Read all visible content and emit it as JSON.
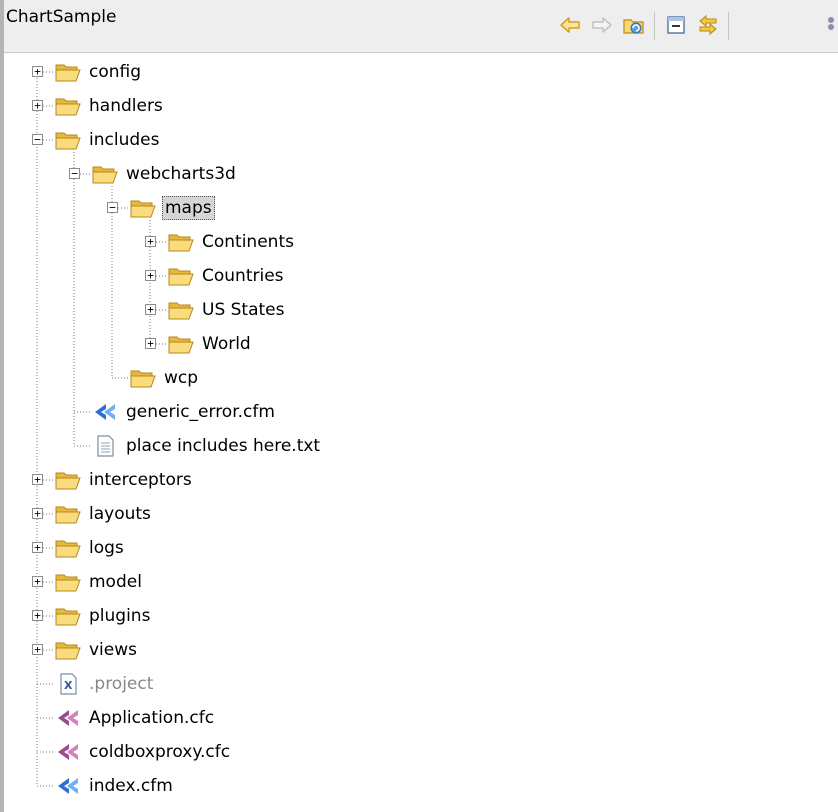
{
  "title": "ChartSample",
  "toolbar": {
    "icons": [
      "back-arrow-icon",
      "forward-arrow-icon",
      "refresh-icon",
      "collapse-all-icon",
      "link-with-editor-icon",
      "view-menu-icon"
    ]
  },
  "tree": [
    {
      "id": "config",
      "label": "config",
      "type": "folder",
      "level": 0,
      "state": "collapsed"
    },
    {
      "id": "handlers",
      "label": "handlers",
      "type": "folder",
      "level": 0,
      "state": "collapsed"
    },
    {
      "id": "includes",
      "label": "includes",
      "type": "folder",
      "level": 0,
      "state": "expanded"
    },
    {
      "id": "webcharts3d",
      "label": "webcharts3d",
      "type": "folder",
      "level": 1,
      "state": "expanded"
    },
    {
      "id": "maps",
      "label": "maps",
      "type": "folder",
      "level": 2,
      "state": "expanded",
      "selected": true
    },
    {
      "id": "continents",
      "label": "Continents",
      "type": "folder",
      "level": 3,
      "state": "collapsed"
    },
    {
      "id": "countries",
      "label": "Countries",
      "type": "folder",
      "level": 3,
      "state": "collapsed"
    },
    {
      "id": "us-states",
      "label": "US States",
      "type": "folder",
      "level": 3,
      "state": "collapsed"
    },
    {
      "id": "world",
      "label": "World",
      "type": "folder",
      "level": 3,
      "state": "collapsed"
    },
    {
      "id": "wcp",
      "label": "wcp",
      "type": "folder",
      "level": 2,
      "state": "leaf"
    },
    {
      "id": "generic-error",
      "label": "generic_error.cfm",
      "type": "cf",
      "level": 1,
      "state": "leaf"
    },
    {
      "id": "place-includes",
      "label": "place includes here.txt",
      "type": "txt",
      "level": 1,
      "state": "leaf"
    },
    {
      "id": "interceptors",
      "label": "interceptors",
      "type": "folder",
      "level": 0,
      "state": "collapsed"
    },
    {
      "id": "layouts",
      "label": "layouts",
      "type": "folder",
      "level": 0,
      "state": "collapsed"
    },
    {
      "id": "logs",
      "label": "logs",
      "type": "folder",
      "level": 0,
      "state": "collapsed"
    },
    {
      "id": "model",
      "label": "model",
      "type": "folder",
      "level": 0,
      "state": "collapsed"
    },
    {
      "id": "plugins",
      "label": "plugins",
      "type": "folder",
      "level": 0,
      "state": "collapsed"
    },
    {
      "id": "views",
      "label": "views",
      "type": "folder",
      "level": 0,
      "state": "collapsed"
    },
    {
      "id": "project",
      "label": ".project",
      "type": "xml",
      "level": 0,
      "state": "leaf",
      "dim": true
    },
    {
      "id": "application",
      "label": "Application.cfc",
      "type": "cfc",
      "level": 0,
      "state": "leaf"
    },
    {
      "id": "coldboxproxy",
      "label": "coldboxproxy.cfc",
      "type": "cfc",
      "level": 0,
      "state": "leaf"
    },
    {
      "id": "index",
      "label": "index.cfm",
      "type": "cf",
      "level": 0,
      "state": "leaf"
    }
  ]
}
